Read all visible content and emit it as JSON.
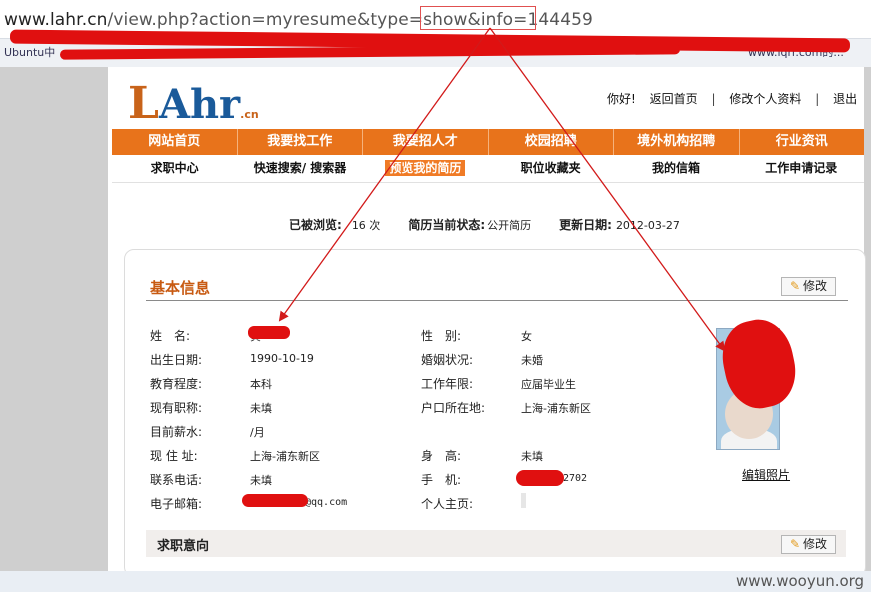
{
  "browser": {
    "url_prefix": "www.lahr.cn",
    "url_rest": "/view.php?action=myresume&type=show&info=144459",
    "bookmark_left": "Ubuntu中",
    "bookmark_right": "www.lqrr.com的..."
  },
  "header": {
    "logo_l": "L",
    "logo_ahr": "Ahr",
    "logo_cn": ".cn",
    "greeting": "你好!",
    "link_home": "返回首页",
    "link_profile": "修改个人资料",
    "link_logout": "退出"
  },
  "nav": {
    "items": [
      "网站首页",
      "我要找工作",
      "我要招人才",
      "校园招聘",
      "境外机构招聘",
      "行业资讯"
    ]
  },
  "subnav": {
    "items": [
      "求职中心",
      "快速搜索/ 搜索器",
      "预览我的简历",
      "职位收藏夹",
      "我的信箱",
      "工作申请记录"
    ]
  },
  "status": {
    "views_label": "已被浏览:",
    "views_value": "16 次",
    "state_label": "简历当前状态:",
    "state_value": "公开简历",
    "updated_label": "更新日期:",
    "updated_value": "2012-03-27"
  },
  "basic": {
    "title": "基本信息",
    "edit_label": "修改",
    "name_label": "姓　名:",
    "name_value": "黄",
    "gender_label": "性　别:",
    "gender_value": "女",
    "birth_label": "出生日期:",
    "birth_value": "1990-10-19",
    "marital_label": "婚姻状况:",
    "marital_value": "未婚",
    "edu_label": "教育程度:",
    "edu_value": "本科",
    "years_label": "工作年限:",
    "years_value": "应届毕业生",
    "title_label": "现有职称:",
    "title_value": "未填",
    "hukou_label": "户口所在地:",
    "hukou_value": "上海-浦东新区",
    "salary_label": "目前薪水:",
    "salary_value": "/月",
    "addr_label": "现 住 址:",
    "addr_value": "上海-浦东新区",
    "height_label": "身　高:",
    "height_value": "未填",
    "phone_label": "联系电话:",
    "phone_value": "未填",
    "mobile_label": "手　机:",
    "mobile_value": "2702",
    "email_label": "电子邮箱:",
    "email_value": "@qq.com",
    "homepage_label": "个人主页:",
    "photo_link": "编辑照片"
  },
  "intent": {
    "title": "求职意向",
    "edit_label": "修改"
  },
  "watermark": "www.wooyun.org",
  "colors": {
    "brand_orange": "#e8731b",
    "title_orange": "#c85a12",
    "redaction_red": "#e01010"
  }
}
